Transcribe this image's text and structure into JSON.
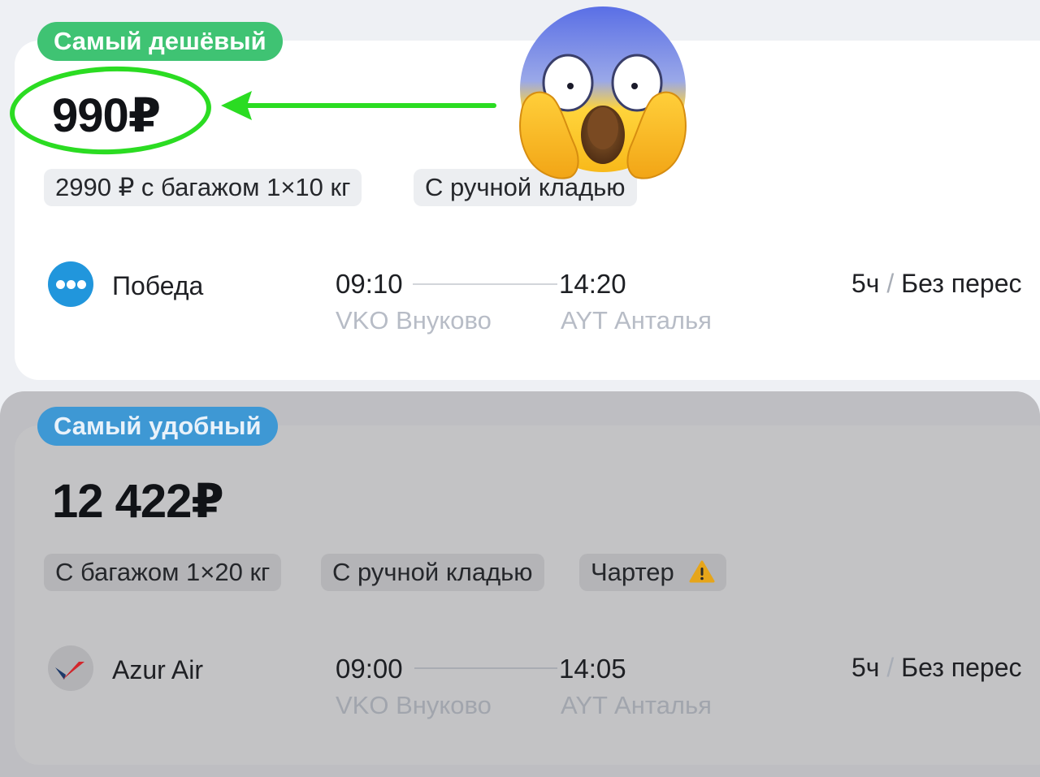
{
  "cheapest": {
    "badge": "Самый дешёвый",
    "price": "990₽",
    "chips": [
      "2990 ₽ с багажом 1×10 кг",
      "С ручной кладью"
    ],
    "airline": "Победа",
    "departure_time": "09:10",
    "departure_airport": "VKO Внуково",
    "arrival_time": "14:20",
    "arrival_airport": "AYT Анталья",
    "duration": "5ч",
    "stops": "Без перес"
  },
  "comfortable": {
    "badge": "Самый удобный",
    "price": "12 422₽",
    "chips": [
      "С багажом 1×20 кг",
      "С ручной кладью",
      "Чартер"
    ],
    "airline": "Azur Air",
    "departure_time": "09:00",
    "departure_airport": "VKO Внуково",
    "arrival_time": "14:05",
    "arrival_airport": "AYT Анталья",
    "duration": "5ч",
    "stops": "Без перес"
  },
  "separator": "/",
  "icons": {
    "pobeda_logo": "pobeda-logo-icon",
    "azur_logo": "azur-air-logo-icon",
    "warning": "warning-icon",
    "emoji": "screaming-face-emoji-icon",
    "arrow": "green-arrow-icon"
  },
  "colors": {
    "green_badge": "#3fc373",
    "blue_badge": "#3e98d4",
    "highlight": "#2bdc22",
    "pobeda_blue": "#2196dc"
  }
}
